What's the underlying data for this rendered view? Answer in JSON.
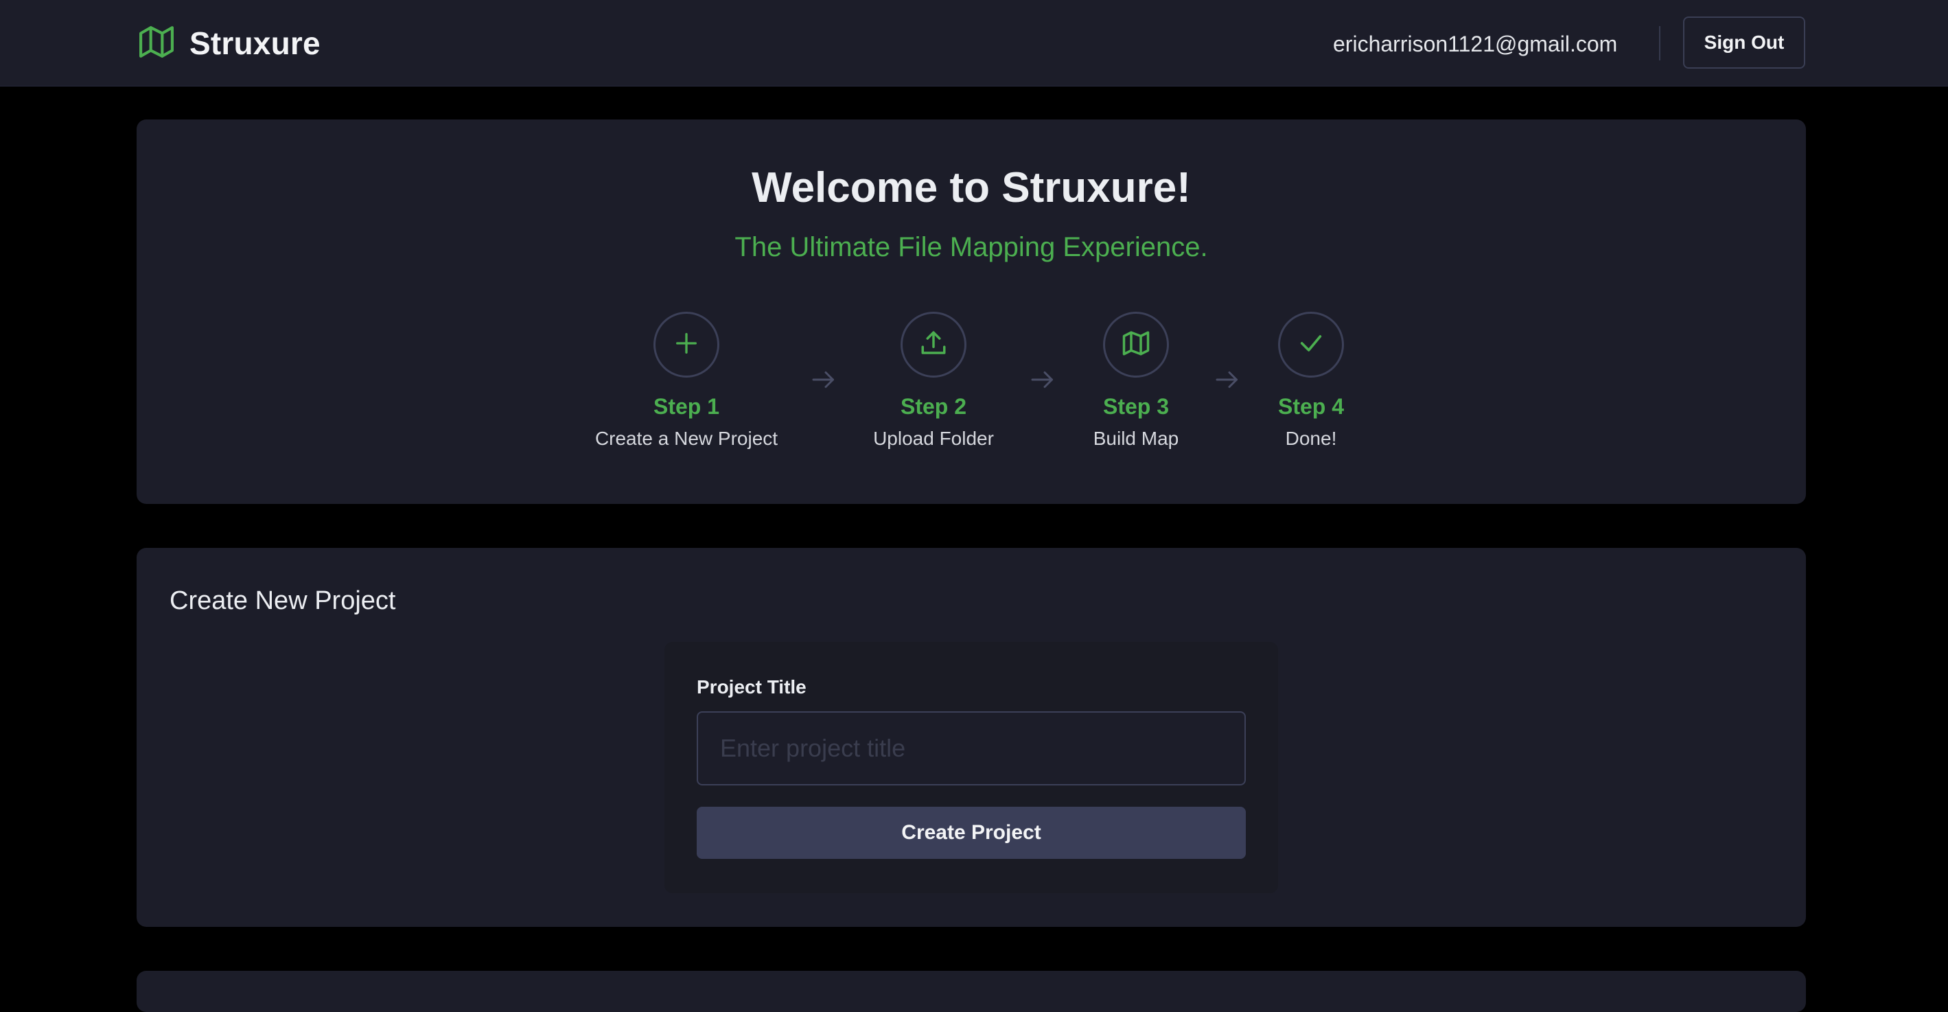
{
  "header": {
    "app_name": "Struxure",
    "logo_icon": "map-icon",
    "user_email": "ericharrison1121@gmail.com",
    "sign_out_label": "Sign Out"
  },
  "welcome": {
    "title": "Welcome to Struxure!",
    "subtitle": "The Ultimate File Mapping Experience.",
    "steps": [
      {
        "label": "Step 1",
        "description": "Create a New Project",
        "icon": "plus-icon"
      },
      {
        "label": "Step 2",
        "description": "Upload Folder",
        "icon": "upload-icon"
      },
      {
        "label": "Step 3",
        "description": "Build Map",
        "icon": "map-icon"
      },
      {
        "label": "Step 4",
        "description": "Done!",
        "icon": "check-icon"
      }
    ]
  },
  "create_project": {
    "section_title": "Create New Project",
    "field_label": "Project Title",
    "input_value": "",
    "input_placeholder": "Enter project title",
    "button_label": "Create Project"
  },
  "colors": {
    "accent_green": "#4caf50",
    "page_background": "#000000",
    "card_background": "#1c1d29",
    "button_background": "#3a3e58"
  }
}
